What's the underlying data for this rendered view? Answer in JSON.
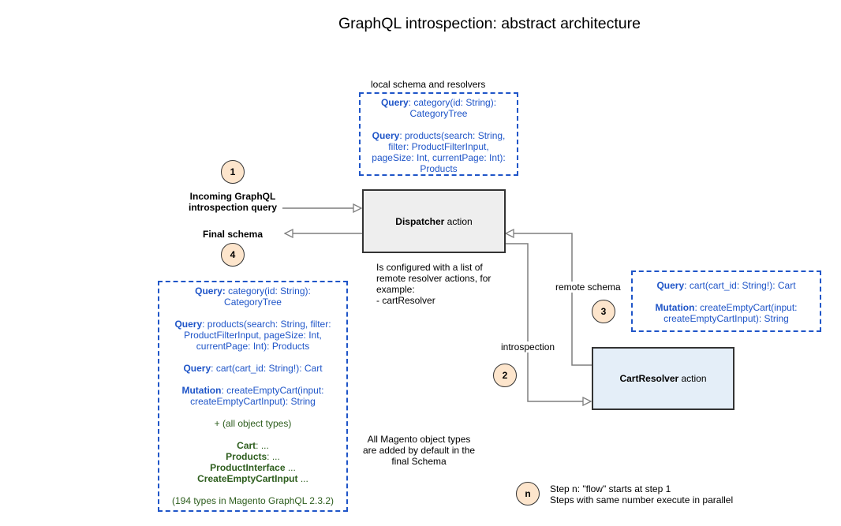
{
  "title": "GraphQL introspection: abstract architecture",
  "colors": {
    "schema_blue": "#1f55c8",
    "object_green": "#2e5e1e",
    "step_fill": "#fde5cc",
    "dispatcher_fill": "#eeeeee",
    "resolver_fill": "#e4eef8",
    "wire": "#7f7f7f"
  },
  "local_schema": {
    "caption": "local schema and resolvers",
    "entries": [
      {
        "kind": "Query",
        "sig": ": category(id: String):",
        "sig2": "CategoryTree"
      },
      {
        "kind": "Query",
        "sig": ": products(search: String,",
        "sig2": "filter: ProductFilterInput,",
        "sig3": "pageSize: Int, currentPage: Int):",
        "sig4": "Products"
      }
    ]
  },
  "steps": {
    "s1": "1",
    "s2": "2",
    "s3": "3",
    "s4": "4",
    "legend": "n"
  },
  "incoming": {
    "line1": "Incoming GraphQL",
    "line2": "introspection query"
  },
  "final_label": "Final schema",
  "dispatcher": {
    "name": "Dispatcher",
    "suffix": " action",
    "note1": "Is configured with a list of",
    "note2": "remote resolver actions, for",
    "note3": "example:",
    "note4": "- cartResolver"
  },
  "resolver": {
    "name": "CartResolver",
    "suffix": " action"
  },
  "edges": {
    "introspection": "introspection",
    "remote_schema": "remote schema"
  },
  "remote_schema": {
    "q_kind": "Query",
    "q_sig": ": cart(cart_id: String!): Cart",
    "m_kind": "Mutation",
    "m_sig": ": createEmptyCart(input:",
    "m_sig2": "createEmptyCartInput): String"
  },
  "final_schema": {
    "e1_kind": "Query:",
    "e1_sig": " category(id: String):",
    "e1_sig2": "CategoryTree",
    "e2_kind": "Query",
    "e2_sig": ": products(search: String, filter:",
    "e2_sig2": "ProductFilterInput, pageSize: Int,",
    "e2_sig3": "currentPage: Int): Products",
    "e3_kind": "Query",
    "e3_sig": ": cart(cart_id: String!): Cart",
    "e4_kind": "Mutation",
    "e4_sig": ": createEmptyCart(input:",
    "e4_sig2": "createEmptyCartInput): String",
    "all_types": "+ (all object types)",
    "types": [
      {
        "name": "Cart",
        "rest": ": ..."
      },
      {
        "name": "Products",
        "rest": ": ..."
      },
      {
        "name": "ProductInterface",
        "rest": " ..."
      },
      {
        "name": "CreateEmptyCartInput",
        "rest": " ..."
      }
    ],
    "count_note": "(194 types in Magento GraphQL 2.3.2)"
  },
  "default_note": {
    "line1": "All Magento object types",
    "line2": "are added by default in the",
    "line3": "final Schema"
  },
  "legend": {
    "line1": "Step n: \"flow\" starts at step 1",
    "line2": "Steps with same number execute in parallel"
  }
}
